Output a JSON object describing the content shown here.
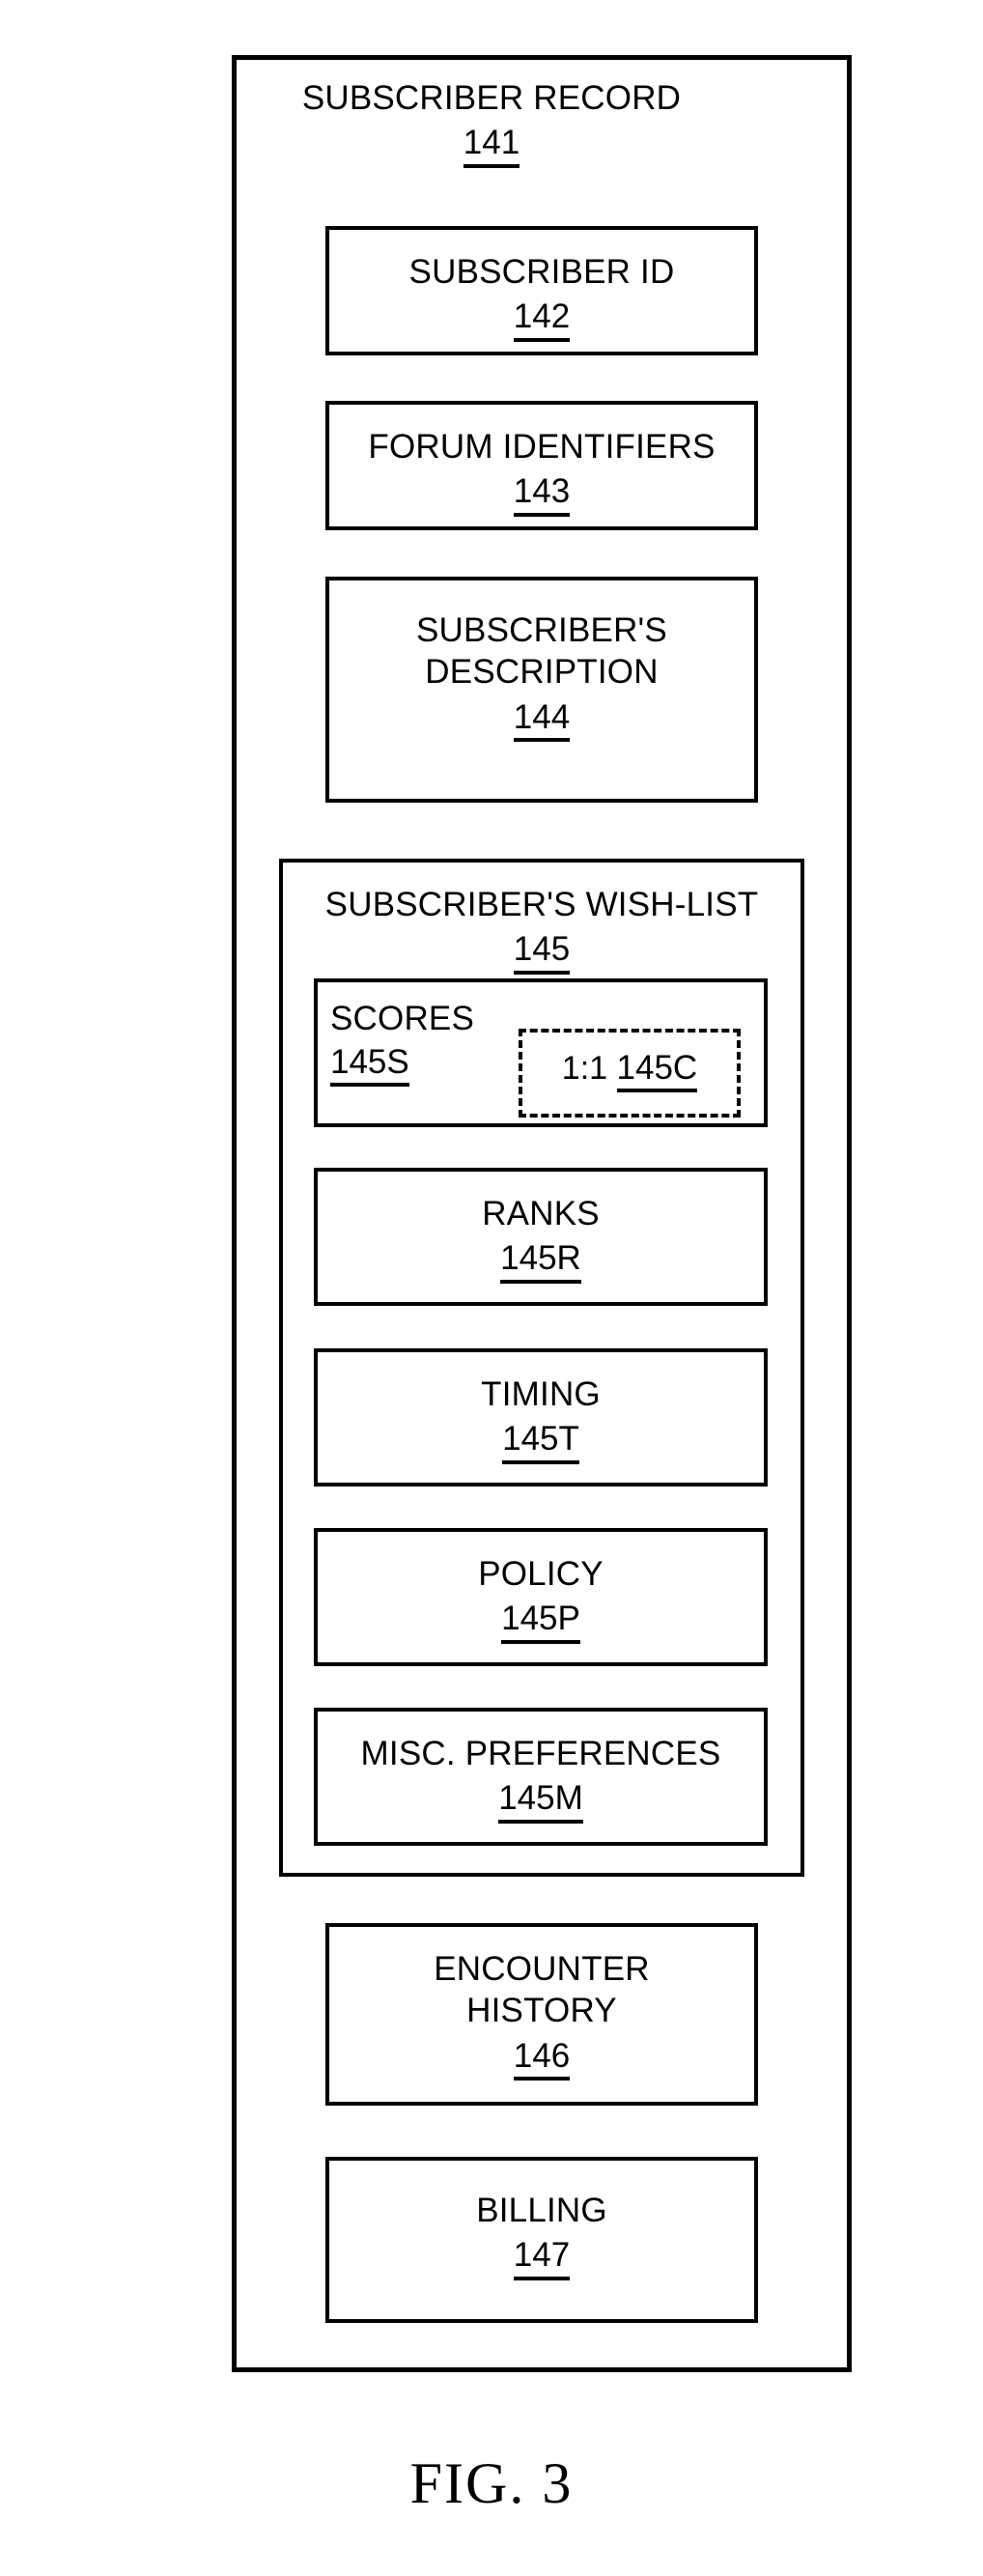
{
  "figure": {
    "caption": "FIG. 3"
  },
  "record": {
    "title": "SUBSCRIBER RECORD",
    "ref": "141"
  },
  "fields": [
    {
      "label": "SUBSCRIBER ID",
      "ref": "142"
    },
    {
      "label": "FORUM IDENTIFIERS",
      "ref": "143"
    },
    {
      "label_line1": "SUBSCRIBER'S",
      "label_line2": "DESCRIPTION",
      "ref": "144"
    }
  ],
  "wishlist": {
    "title": "SUBSCRIBER'S WISH-LIST",
    "ref": "145",
    "items": [
      {
        "label": "SCORES",
        "ref": "145S"
      },
      {
        "label": "RANKS",
        "ref": "145R"
      },
      {
        "label": "TIMING",
        "ref": "145T"
      },
      {
        "label": "POLICY",
        "ref": "145P"
      },
      {
        "label": "MISC. PREFERENCES",
        "ref": "145M"
      }
    ],
    "one_to_one": {
      "label": "1:1",
      "ref": "145C"
    }
  },
  "footer_fields": [
    {
      "label_line1": "ENCOUNTER",
      "label_line2": "HISTORY",
      "ref": "146"
    },
    {
      "label": "BILLING",
      "ref": "147"
    }
  ],
  "colors": {
    "ink": "#000000",
    "paper": "#ffffff"
  }
}
